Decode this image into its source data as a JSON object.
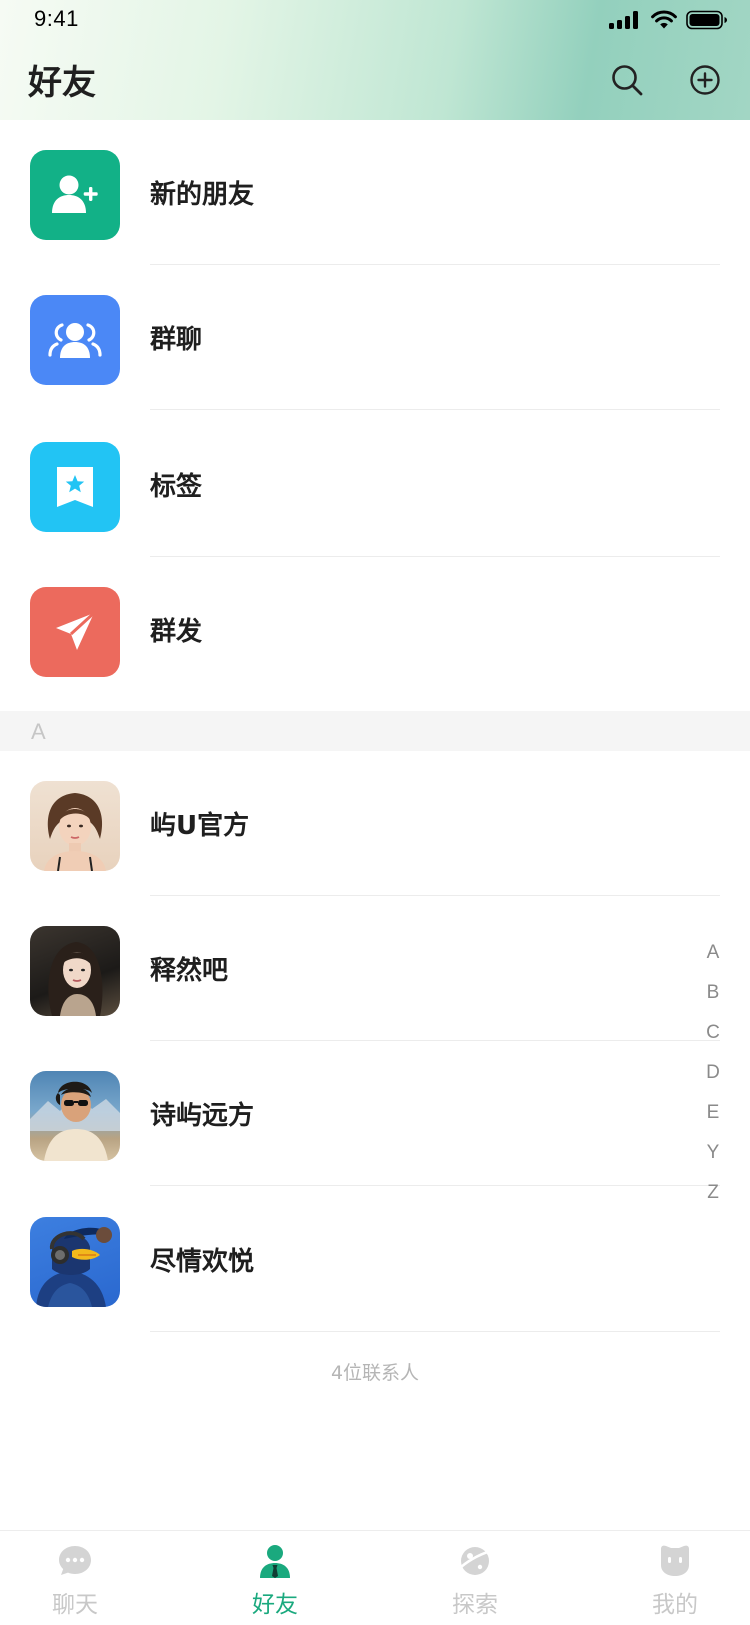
{
  "status_bar": {
    "time": "9:41"
  },
  "header": {
    "title": "好友"
  },
  "functions": [
    {
      "label": "新的朋友",
      "icon": "add-friend-icon",
      "color": "#12b187"
    },
    {
      "label": "群聊",
      "icon": "group-chat-icon",
      "color": "#4b88f6"
    },
    {
      "label": "标签",
      "icon": "tag-bookmark-icon",
      "color": "#22c4f4"
    },
    {
      "label": "群发",
      "icon": "paper-plane-icon",
      "color": "#ec6a5d"
    }
  ],
  "section": {
    "letter": "A"
  },
  "contacts": [
    {
      "name": "屿U官方",
      "avatar": "avatar-woman-short-hair"
    },
    {
      "name": "释然吧",
      "avatar": "avatar-woman-long-hair"
    },
    {
      "name": "诗屿远方",
      "avatar": "avatar-man-sunglasses"
    },
    {
      "name": "尽情欢悦",
      "avatar": "avatar-figure-headphones"
    }
  ],
  "index_letters": [
    "A",
    "B",
    "C",
    "D",
    "E",
    "Y",
    "Z"
  ],
  "footer": {
    "contact_count": "4位联系人"
  },
  "tabbar": {
    "items": [
      {
        "label": "聊天",
        "icon": "chat-bubble-icon",
        "active": false
      },
      {
        "label": "好友",
        "icon": "person-icon",
        "active": true
      },
      {
        "label": "探索",
        "icon": "planet-icon",
        "active": false
      },
      {
        "label": "我的",
        "icon": "face-icon",
        "active": false
      }
    ],
    "active_color": "#1aa97e",
    "inactive_color": "#d4d4d4"
  }
}
